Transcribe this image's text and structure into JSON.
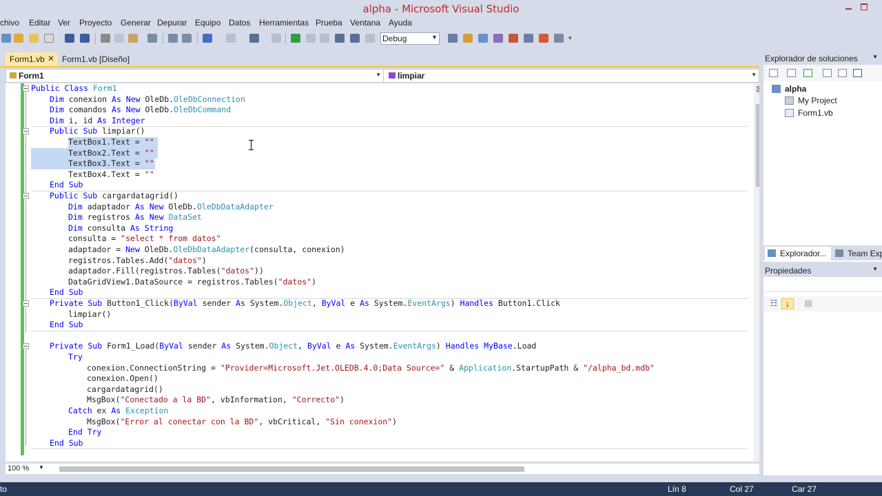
{
  "window": {
    "title": "alpha - Microsoft Visual Studio"
  },
  "menu": [
    "chivo",
    "Editar",
    "Ver",
    "Proyecto",
    "Generar",
    "Depurar",
    "Equipo",
    "Datos",
    "Herramientas",
    "Prueba",
    "Ventana",
    "Ayuda"
  ],
  "toolbar": {
    "configuration": "Debug"
  },
  "tabs": [
    {
      "label": "Form1.vb",
      "active": true
    },
    {
      "label": "Form1.vb [Diseño]",
      "active": false
    }
  ],
  "navbar": {
    "class_name": "Form1",
    "member_name": "limpiar"
  },
  "code": {
    "lines": [
      [
        "Public Class",
        " Form1"
      ],
      [
        "Dim",
        " conexion ",
        "As New",
        " OleDb.",
        "OleDbConnection"
      ],
      [
        "Dim",
        " comandos ",
        "As New",
        " OleDb.",
        "OleDbCommand"
      ],
      [
        "Dim",
        " i, id ",
        "As Integer"
      ],
      [
        "Public Sub",
        " limpiar()"
      ],
      [
        "TextBox1.Text = ",
        "\"\""
      ],
      [
        "TextBox2.Text = ",
        "\"\""
      ],
      [
        "TextBox3.Text = ",
        "\"\""
      ],
      [
        "TextBox4.Text = ",
        "\"\""
      ],
      [
        "End Sub"
      ],
      [
        "Public Sub",
        " cargardatagrid()"
      ],
      [
        "Dim",
        " adaptador ",
        "As New",
        " OleDb.",
        "OleDbDataAdapter"
      ],
      [
        "Dim",
        " registros ",
        "As New",
        " ",
        "DataSet"
      ],
      [
        "Dim",
        " consulta ",
        "As String"
      ],
      [
        "consulta = ",
        "\"select * from datos\""
      ],
      [
        "adaptador = ",
        "New",
        " OleDb.",
        "OleDbDataAdapter",
        "(consulta, conexion)"
      ],
      [
        "registros.Tables.Add(",
        "\"datos\"",
        ")"
      ],
      [
        "adaptador.Fill(registros.Tables(",
        "\"datos\"",
        "))"
      ],
      [
        "DataGridView1.DataSource = registros.Tables(",
        "\"datos\"",
        ")"
      ],
      [
        "End Sub"
      ],
      [
        "Private Sub",
        " Button1_Click(",
        "ByVal",
        " sender ",
        "As",
        " System.",
        "Object",
        ", ",
        "ByVal",
        " e ",
        "As",
        " System.",
        "EventArgs",
        ") ",
        "Handles",
        " Button1.Click"
      ],
      [
        "limpiar()"
      ],
      [
        "End Sub"
      ],
      [
        ""
      ],
      [
        "Private Sub",
        " Form1_Load(",
        "ByVal",
        " sender ",
        "As",
        " System.",
        "Object",
        ", ",
        "ByVal",
        " e ",
        "As",
        " System.",
        "EventArgs",
        ") ",
        "Handles",
        " ",
        "MyBase",
        ".Load"
      ],
      [
        "Try"
      ],
      [
        "conexion.ConnectionString = ",
        "\"Provider=Microsoft.Jet.OLEDB.4.0;Data Source=\"",
        " & ",
        "Application",
        ".StartupPath & ",
        "\"/alpha_bd.mdb\""
      ],
      [
        "conexion.Open()"
      ],
      [
        "cargardatagrid()"
      ],
      [
        "MsgBox(",
        "\"Conectado a la BD\"",
        ", vbInformation, ",
        "\"Correcto\"",
        ")"
      ],
      [
        "Catch",
        " ex ",
        "As",
        " ",
        "Exception"
      ],
      [
        "MsgBox(",
        "\"Error al conectar con la BD\"",
        ", vbCritical, ",
        "\"Sin conexion\"",
        ")"
      ],
      [
        "End Try"
      ],
      [
        "End Sub"
      ]
    ]
  },
  "zoom": "100 %",
  "status": {
    "left": "to",
    "line": "Lín 8",
    "col": "Col 27",
    "car": "Car 27"
  },
  "solution_explorer": {
    "title": "Explorador de soluciones",
    "items": [
      "alpha",
      "My Project",
      "Form1.vb"
    ]
  },
  "panel_tabs": [
    "Explorador...",
    "Team Exp"
  ],
  "properties": {
    "title": "Propiedades"
  }
}
